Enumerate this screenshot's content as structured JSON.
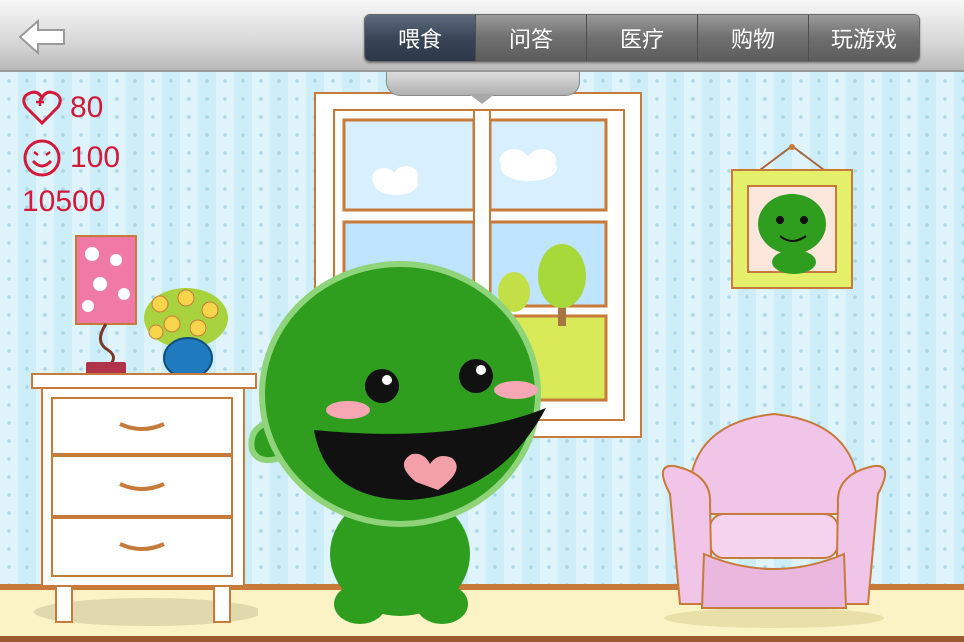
{
  "header": {
    "back_icon": "back-arrow-icon",
    "tabs": [
      {
        "label": "喂食",
        "active": true
      },
      {
        "label": "问答",
        "active": false
      },
      {
        "label": "医疗",
        "active": false
      },
      {
        "label": "购物",
        "active": false
      },
      {
        "label": "玩游戏",
        "active": false
      }
    ]
  },
  "stats": {
    "health": "80",
    "mood": "100",
    "coins": "10500",
    "health_icon": "heart-plus-icon",
    "mood_icon": "smiley-icon"
  },
  "colors": {
    "accent": "#d3193a",
    "pet_green": "#2f9e1f",
    "wallpaper": "#cdeef8"
  }
}
